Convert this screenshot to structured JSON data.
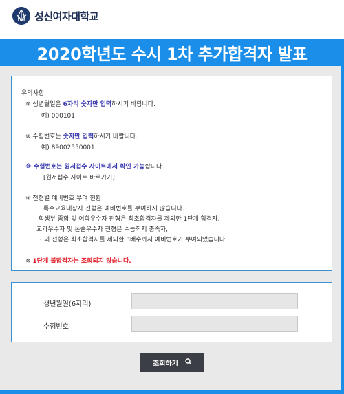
{
  "header": {
    "logo_text": "성신여자대학교",
    "logo_icon": "university-emblem-icon"
  },
  "title": "2020학년도 수시 1차 추가합격자 발표",
  "notice": {
    "heading": "유의사항",
    "item1_prefix": "※ 생년월일은 ",
    "item1_highlight": "6자리 숫자만 입력",
    "item1_suffix": "하시기 바랍니다.",
    "item1_example": "예) 000101",
    "item2_prefix": "※ 수험번호는 ",
    "item2_highlight": "숫자만 입력",
    "item2_suffix": "하시기 바랍니다.",
    "item2_example": "예) 89002550001",
    "item3_highlight": "※ 수험번호는 원서접수 사이트에서 확인 가능",
    "item3_suffix": "합니다.",
    "item3_link": "[원서접수 사이트 바로가기]",
    "item4_heading": "※ 전형별 예비번호 부여 현황",
    "item4_line1": "특수교육대상자 전형은 예비번호를 부여하지 않습니다.",
    "item4_line2": "학생부 종합 및 어학우수자 전형은 최초합격자를 제외한 1단계 합격자,",
    "item4_line3": "교과우수자 및 논술우수자 전형은 수능최저 충족자,",
    "item4_line4": "그 외 전형은 최초합격자를 제외한 3배수까지 예비번호가 부여되었습니다.",
    "item5_mark": "※ ",
    "item5_text": "1단계 불합격자는 조회되지 않습니다."
  },
  "form": {
    "birth_label": "생년월일(6자리)",
    "birth_value": "",
    "exam_label": "수험번호",
    "exam_value": ""
  },
  "search_button": {
    "label": "조회하기",
    "icon": "search-icon"
  },
  "colors": {
    "accent": "#1a8ee8",
    "highlight_blue": "#3a3ab0",
    "warning_red": "#e0202b",
    "button_dark": "#3b3f45"
  }
}
